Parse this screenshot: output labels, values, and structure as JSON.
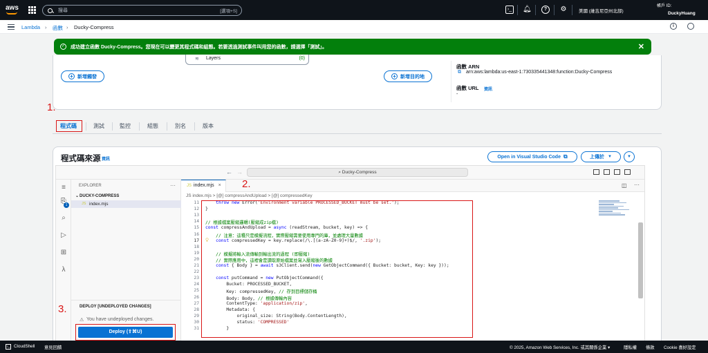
{
  "topnav": {
    "logo": "aws",
    "search_placeholder": "搜尋",
    "search_shortcut": "[選項+S]",
    "region": "美國 (維吉尼亞州北部)",
    "account": "帳戶 ID:",
    "user": "DuckyHuang"
  },
  "breadcrumb": [
    "Lambda",
    "函數",
    "Ducky-Compress"
  ],
  "banner": {
    "message": "成功建立函數 Ducky-Compress。您現在可以變更其程式碼和組態。若要透過測試事件叫用您的函數，請選擇「測試」。"
  },
  "overview": {
    "layers_label": "Layers",
    "layers_count": "(0)",
    "add_trigger": "新增觸發",
    "add_destination": "新增目的地",
    "arn_label": "函數 ARN",
    "arn_value": "arn:aws:lambda:us-east-1:730335441348:function:Ducky-Compress",
    "url_label": "函數 URL",
    "url_info": "資訊",
    "url_value": "-"
  },
  "tabs": [
    "程式碼",
    "測試",
    "監控",
    "組態",
    "別名",
    "版本"
  ],
  "annotations": [
    "1.",
    "2.",
    "3."
  ],
  "code_source": {
    "title": "程式碼來源",
    "info": "資訊",
    "open_vscode": "Open in Visual Studio Code",
    "upload": "上傳於"
  },
  "ide": {
    "search": "Ducky-Compress",
    "explorer_title": "EXPLORER",
    "folder": "DUCKY-COMPRESS",
    "file": "index.mjs",
    "tab": "index.mjs",
    "breadcrumb": "JS index.mjs > [@] compressAndUpload > [@] compressedKey",
    "deploy_section": "DEPLOY [UNDEPLOYED CHANGES]",
    "warning": "You have undeployed changes.",
    "deploy_button": "Deploy (⇧⌘U)",
    "badge": "1"
  },
  "code_lines": [
    {
      "n": "11",
      "t": "    throw new Error('Environment variable PROCESSED_BUCKET must be set.');"
    },
    {
      "n": "12",
      "t": "}"
    },
    {
      "n": "13",
      "t": ""
    },
    {
      "n": "14",
      "t": "// 根據檔案壓縮邏輯(壓縮成zip檔)"
    },
    {
      "n": "15",
      "t": "const compressAndUpload = async (readStream, bucket, key) => {"
    },
    {
      "n": "16",
      "t": "    // 注意：這種只是模擬流程，實際壓縮需要使用專門的庫，並處理大量數據"
    },
    {
      "n": "17",
      "t": "    const compressedKey = key.replace(/\\.[(a-zA-Z0-9]+)$/, '.zip');"
    },
    {
      "n": "18",
      "t": ""
    },
    {
      "n": "19",
      "t": "    // 模擬將輸入流傳輸到輸出流的過程 (即壓縮)"
    },
    {
      "n": "20",
      "t": "    // 實際應用中，這裡會是讀取原始檔案並寫入壓縮後的數據"
    },
    {
      "n": "21",
      "t": "    const { Body } = await s3Client.send(new GetObjectCommand({ Bucket: bucket, Key: key }));"
    },
    {
      "n": "22",
      "t": ""
    },
    {
      "n": "23",
      "t": "    const putCommand = new PutObjectCommand({"
    },
    {
      "n": "24",
      "t": "        Bucket: PROCESSED_BUCKET,"
    },
    {
      "n": "25",
      "t": "        Key: compressedKey, // 存到目標儲存桶"
    },
    {
      "n": "26",
      "t": "        Body: Body, // 根據傳輸內容"
    },
    {
      "n": "27",
      "t": "        ContentType: 'application/zip',"
    },
    {
      "n": "28",
      "t": "        Metadata: {"
    },
    {
      "n": "29",
      "t": "            original_size: String(Body.ContentLength),"
    },
    {
      "n": "30",
      "t": "            status: 'COMPRESSED'"
    },
    {
      "n": "31",
      "t": "        }"
    }
  ],
  "footer": {
    "cloudshell": "CloudShell",
    "feedback": "意見回饋",
    "copyright": "© 2025, Amazon Web Services, Inc. 或其關係企業 ▾",
    "privacy": "隱私權",
    "terms": "條款",
    "cookies": "Cookie 喜好設定"
  }
}
